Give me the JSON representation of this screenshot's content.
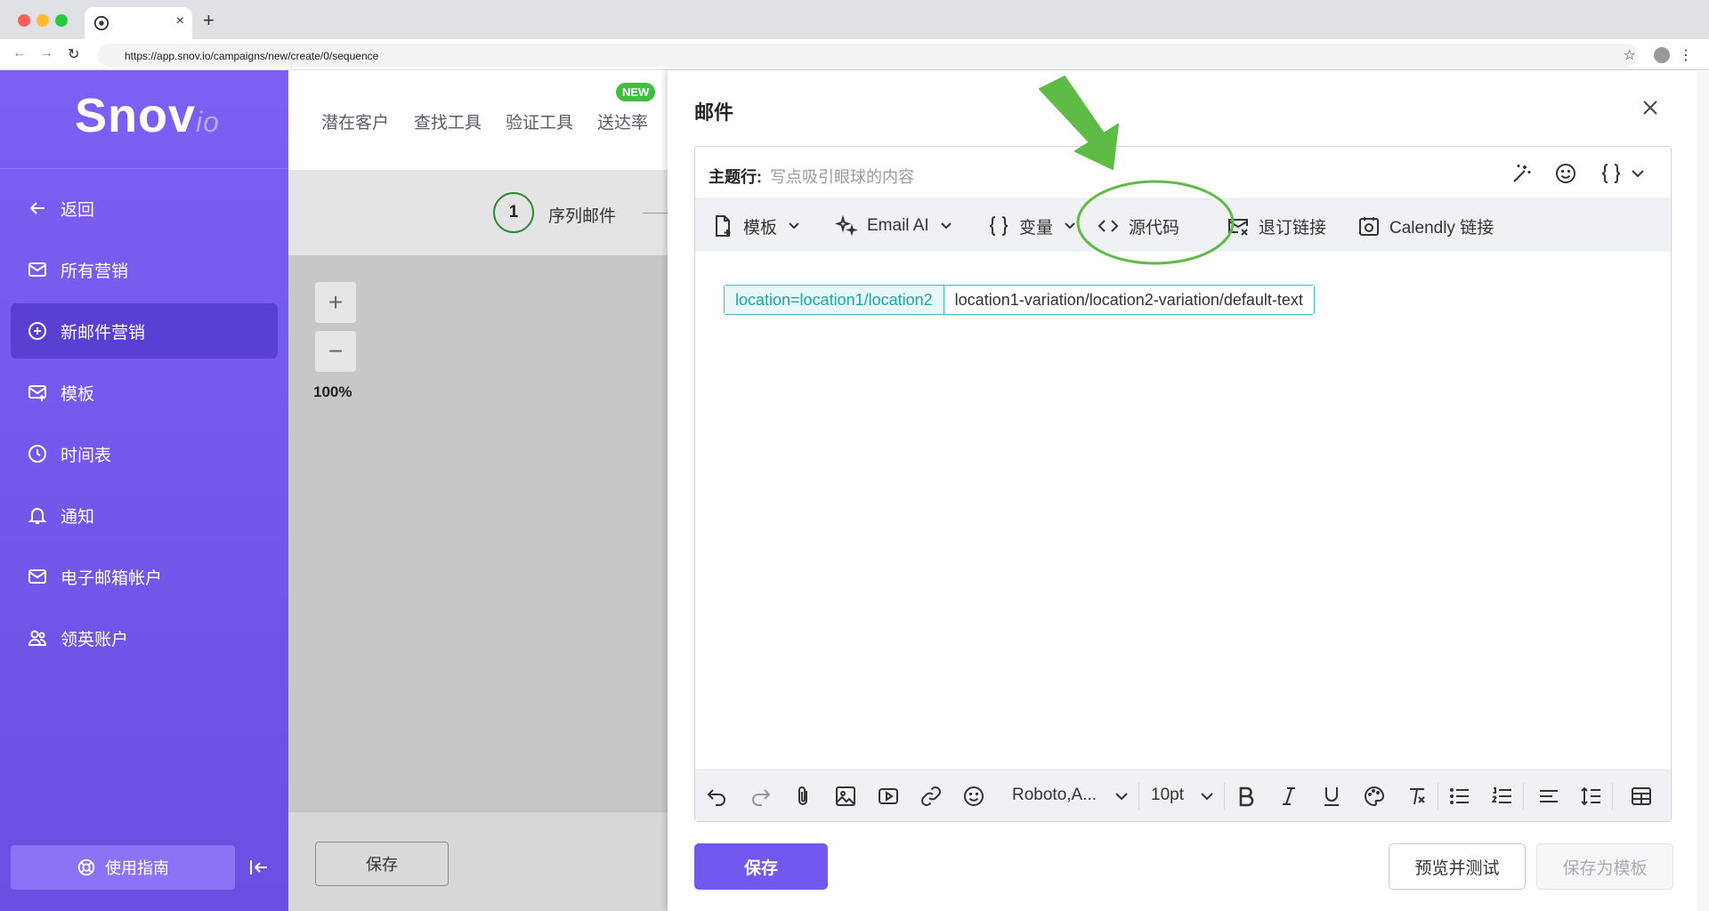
{
  "browser": {
    "url": "https://app.snov.io/campaigns/new/create/0/sequence",
    "tab_close": "×",
    "new_tab": "+"
  },
  "sidebar": {
    "logo_main": "Snov",
    "logo_sub": "io",
    "items": [
      {
        "label": "返回",
        "icon": "arrow-left-icon"
      },
      {
        "label": "所有营销",
        "icon": "mail-icon"
      },
      {
        "label": "新邮件营销",
        "icon": "plus-circle-icon",
        "active": true
      },
      {
        "label": "模板",
        "icon": "mail-template-icon"
      },
      {
        "label": "时间表",
        "icon": "clock-icon"
      },
      {
        "label": "通知",
        "icon": "bell-icon"
      },
      {
        "label": "电子邮箱帐户",
        "icon": "mail-icon"
      },
      {
        "label": "领英账户",
        "icon": "users-icon"
      }
    ],
    "guide_label": "使用指南"
  },
  "topnav": {
    "items": [
      "潜在客户",
      "查找工具",
      "验证工具",
      "送达率"
    ],
    "badge": "NEW"
  },
  "workarea": {
    "step_number": "1",
    "step_label": "序列邮件",
    "zoom_in": "+",
    "zoom_out": "−",
    "zoom_level": "100%",
    "save_label": "保存"
  },
  "email_panel": {
    "title": "邮件",
    "subject_label": "主题行:",
    "subject_placeholder": "写点吸引眼球的内容",
    "toolbar": {
      "template": "模板",
      "email_ai": "Email AI",
      "variables": "变量",
      "source_code": "源代码",
      "unsubscribe": "退订链接",
      "calendly": "Calendly 链接"
    },
    "variable_chip": {
      "key": "location=location1/location2",
      "value": "location1-variation/location2-variation/default-text"
    },
    "format_bar": {
      "font": "Roboto,A...",
      "size": "10pt"
    },
    "save_label": "保存",
    "preview_label": "预览并测试",
    "save_template_label": "保存为模板"
  },
  "colors": {
    "sidebar": "#7b5ef2",
    "accent": "#7358f0",
    "annotation_green": "#5dbb46",
    "variable_teal": "#1aa6a6"
  }
}
